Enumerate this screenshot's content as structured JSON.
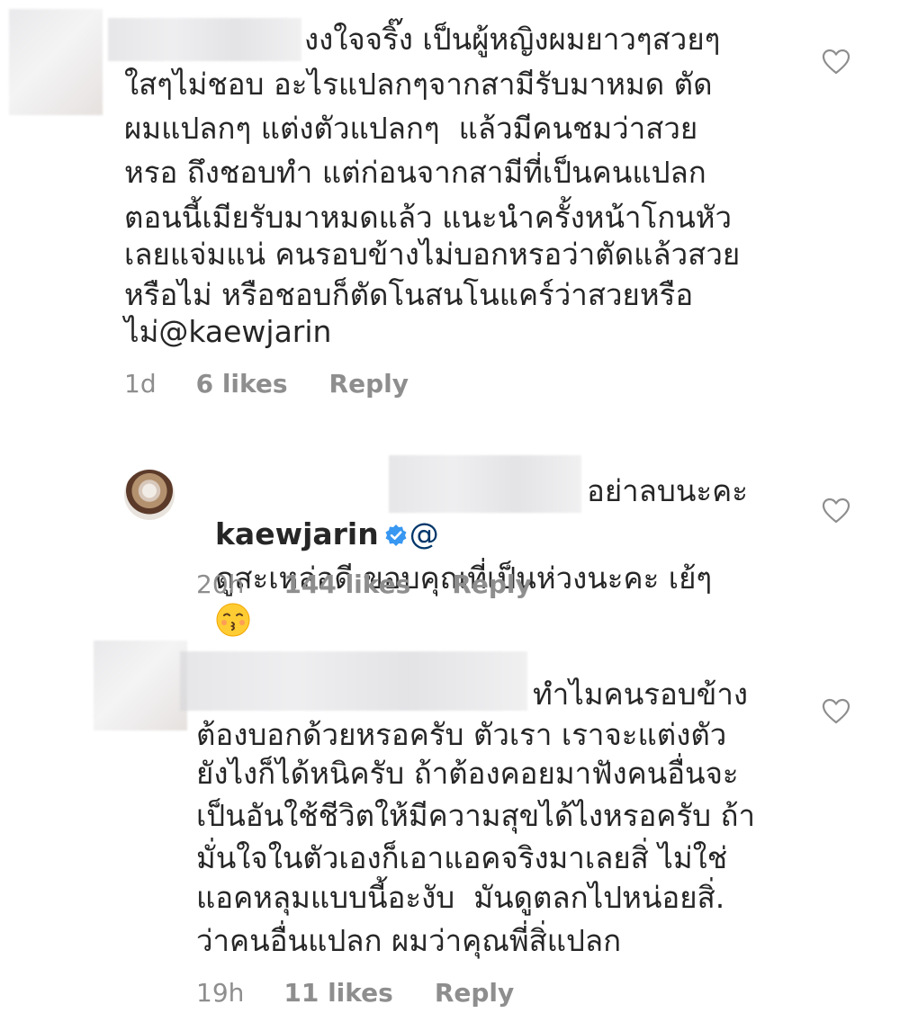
{
  "comments": [
    {
      "lines": [
        "งงใจจริ๊ง เป็นผู้หญิงผมยาวๆสวยๆ",
        "ใสๆไม่ชอบ อะไรแปลกๆจากสามีรับมาหมด ตัด",
        "ผมแปลกๆ แต่งตัวแปลกๆ  แล้วมีคนชมว่าสวย",
        "หรอ ถึงชอบทำ แต่ก่อนจากสามีที่เป็นคนแปลก",
        "ตอนนี้เมียรับมาหมดแล้ว แนะนำครั้งหน้าโกนหัว",
        "เลยแจ่มแน่ คนรอบข้างไม่บอกหรอว่าตัดแล้วสวย",
        "หรือไม่ หรือชอบก็ตัดโนสนโนแคร์ว่าสวยหรือ",
        "ไม่@kaewjarin"
      ],
      "time": "1d",
      "likes": "6 likes",
      "reply": "Reply"
    },
    {
      "username": "kaewjarin",
      "mention_prefix": "@",
      "line1_tail": "อย่าลบนะคะ",
      "line2": "ดูสะเหล่อดี ขอบคุณที่เป็นห่วงนะคะ เย้ๆ",
      "emoji": "kissing-face-emoji",
      "time": "20h",
      "likes": "144 likes",
      "reply": "Reply"
    },
    {
      "lines": [
        "ทำไมคนรอบข้าง",
        "ต้องบอกด้วยหรอครับ ตัวเรา เราจะแต่งตัว",
        "ยังไงก็ได้หนิครับ ถ้าต้องคอยมาฟังคนอื่นจะ",
        "เป็นอันใช้ชีวิตให้มีความสุขได้ไงหรอครับ ถ้า",
        "มั่นใจในตัวเองก็เอาแอคจริงมาเลยสิ่ ไม่ใช่",
        "แอคหลุมแบบนี้อะงับ  มันดูตลกไปหน่อยสิ่.",
        "ว่าคนอื่นแปลก ผมว่าคุณพี่สิ่แปลก"
      ],
      "time": "19h",
      "likes": "11 likes",
      "reply": "Reply"
    }
  ],
  "icons": {
    "like": "heart-outline-icon",
    "verified": "verified-badge-icon"
  },
  "colors": {
    "text": "#262626",
    "meta": "#8e8e8e",
    "verified": "#3897f0"
  }
}
